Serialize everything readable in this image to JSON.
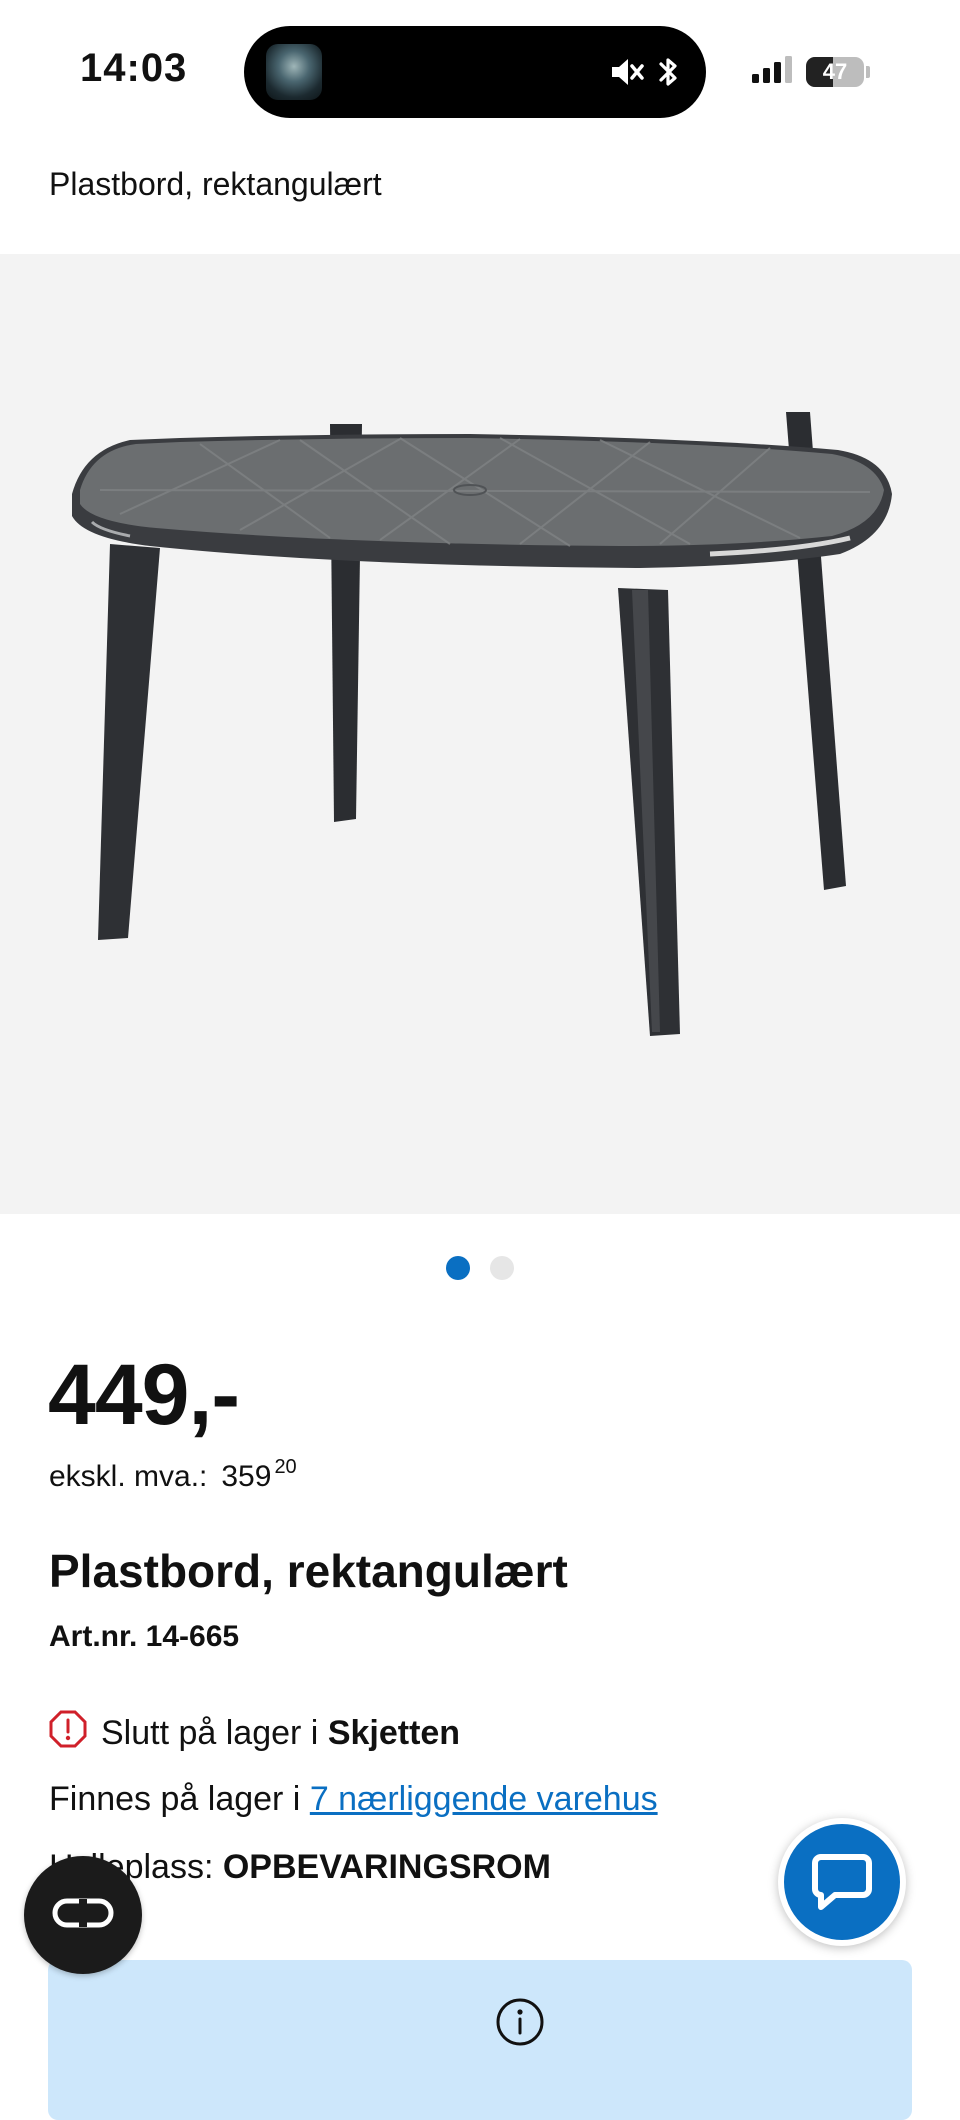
{
  "status_bar": {
    "time": "14:03",
    "battery_level": "47",
    "battery_fraction": 0.47
  },
  "header": {
    "title": "Plastbord, rektangulært"
  },
  "gallery": {
    "image_icon": "plastic-table-image",
    "slide_count": 2,
    "active_slide": 1
  },
  "price": {
    "main": "449,-",
    "ex_vat_label": "ekskl. mva.:",
    "ex_vat_whole": "359",
    "ex_vat_cents": "20"
  },
  "product": {
    "title": "Plastbord, rektangulært",
    "article_number": "Art.nr. 14-665"
  },
  "stock": {
    "out_of_stock_prefix": "Slutt på lager i",
    "store": "Skjetten",
    "available_prefix": "Finnes på lager i",
    "nearby_link": "7 nærliggende varehus",
    "shelf_label": "Hylleplass:",
    "shelf_value": "OPBEVARINGSROM"
  },
  "colors": {
    "accent": "#0a6fc2",
    "info_bg": "#cde7fb",
    "alert": "#d0202a"
  }
}
